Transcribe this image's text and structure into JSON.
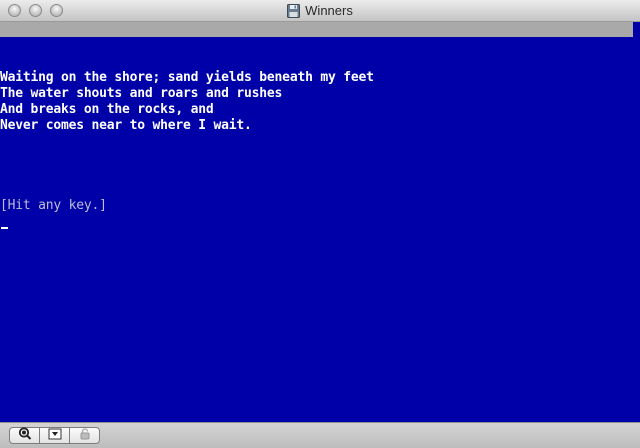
{
  "window": {
    "title": "Winners",
    "title_icon": "floppy-disk-icon"
  },
  "screen": {
    "background": "#0000a8",
    "text_color": "#ffffff",
    "lines": [
      "Waiting on the shore; sand yields beneath my feet",
      "The water shouts and roars and rushes",
      "And breaks on the rocks, and",
      "Never comes near to where I wait."
    ],
    "prompt": "[Hit any key.]"
  },
  "bottombar": {
    "buttons": [
      {
        "icon": "magnifier-icon"
      },
      {
        "icon": "dropdown-arrow-icon"
      },
      {
        "icon": "lock-icon"
      }
    ]
  }
}
